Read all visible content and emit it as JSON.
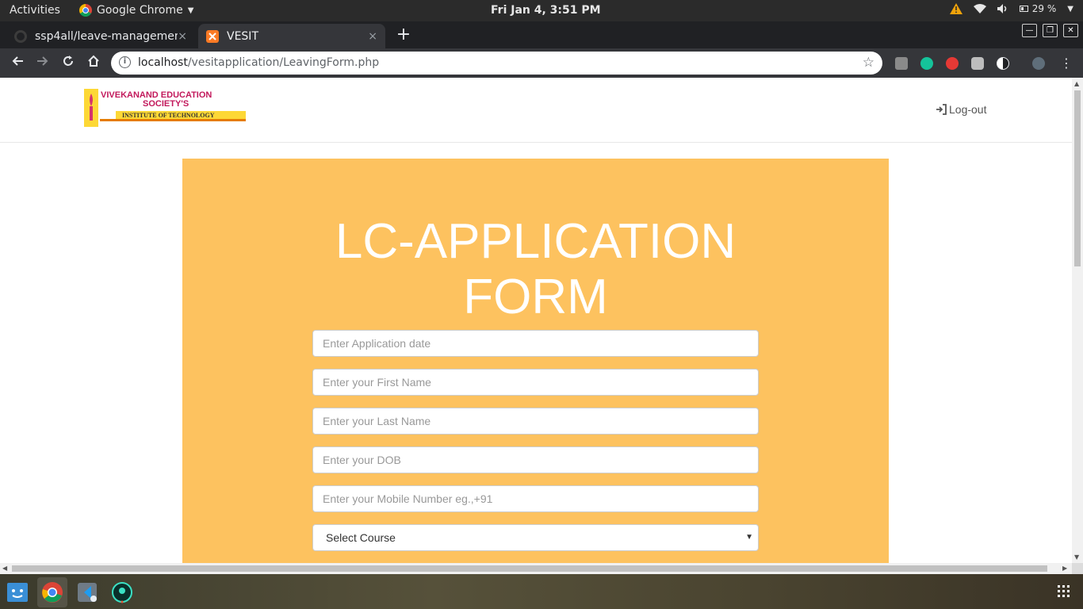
{
  "system_bar": {
    "activities": "Activities",
    "app_name": "Google Chrome",
    "datetime": "Fri Jan  4,  3:51 PM",
    "battery": "29 %"
  },
  "tabs": [
    {
      "title": "ssp4all/leave-managemen",
      "close": "×"
    },
    {
      "title": "VESIT",
      "close": "×"
    }
  ],
  "address_bar": {
    "host": "localhost",
    "path": "/vesitapplication/LeavingForm.php"
  },
  "site": {
    "logo": {
      "line1": "VIVEKANAND EDUCATION",
      "line2": "SOCIETY'S",
      "line3": "INSTITUTE OF TECHNOLOGY"
    },
    "logout_label": "Log-out"
  },
  "form": {
    "title_line1": "LC-APPLICATION",
    "title_line2": "FORM",
    "fields": {
      "application_date": "Enter Application date",
      "first_name": "Enter your First Name",
      "last_name": "Enter your Last Name",
      "dob": "Enter your DOB",
      "mobile": "Enter your Mobile Number eg.,+91"
    },
    "course_select": "Select Course"
  },
  "colors": {
    "panel_bg": "#fdc25f",
    "chrome_dark": "#35363a"
  }
}
